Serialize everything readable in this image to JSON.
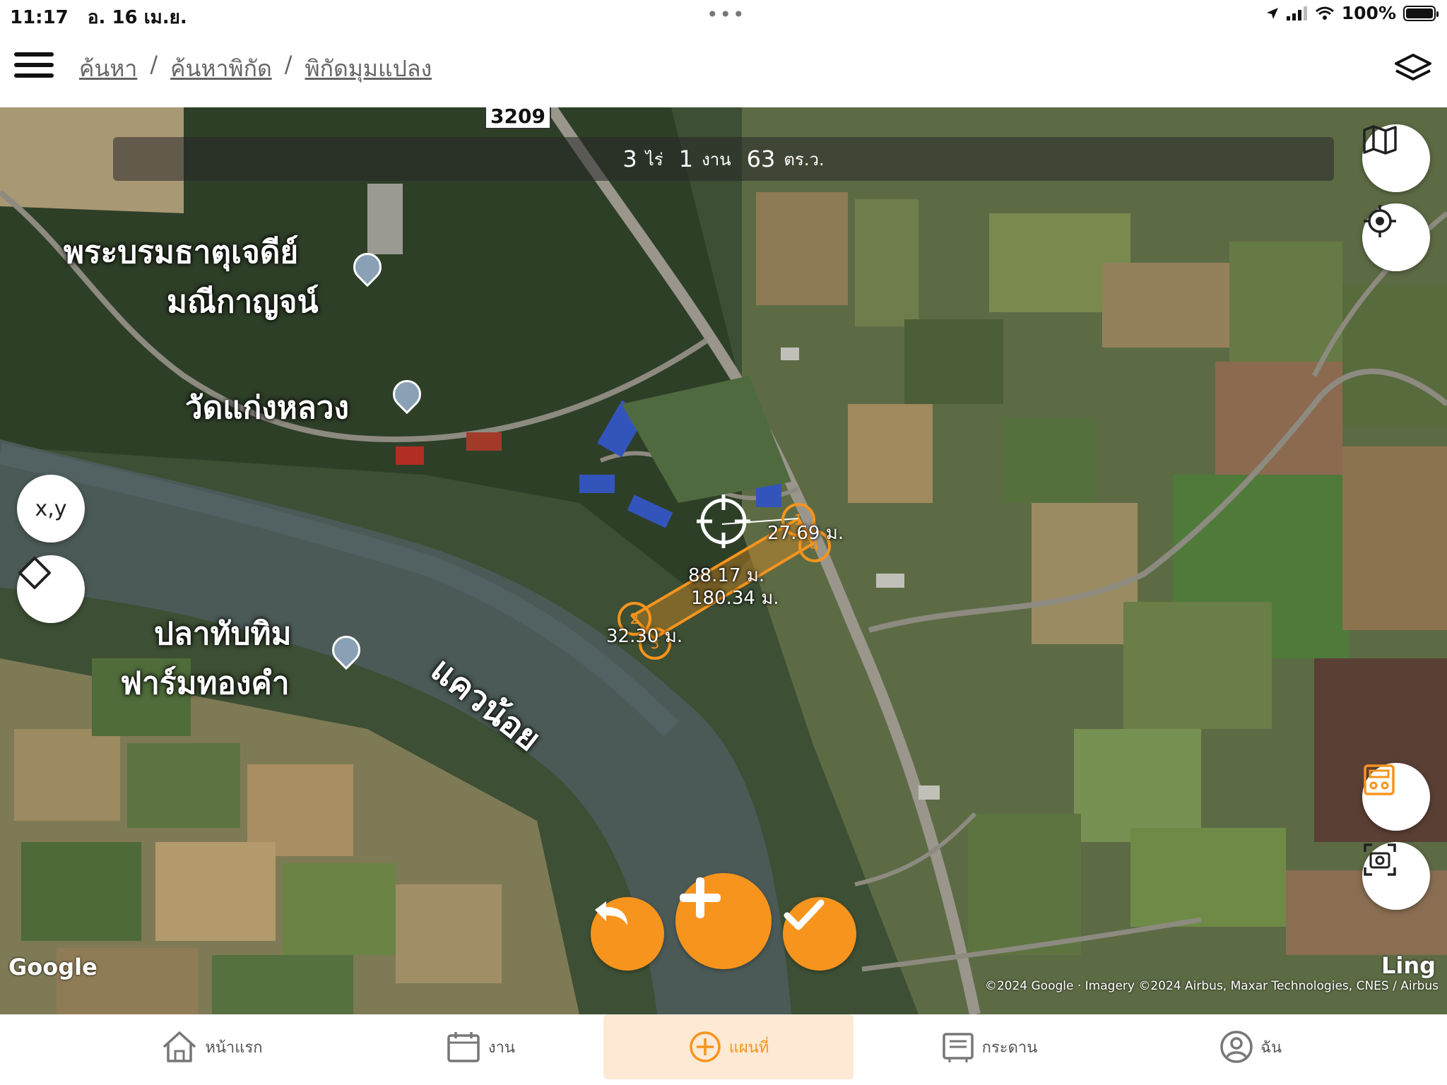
{
  "status": {
    "time": "11:17",
    "date": "อ. 16 เม.ย.",
    "battery": "100%"
  },
  "header": {
    "breadcrumb": [
      "ค้นหา",
      "ค้นหาพิกัด",
      "พิกัดมุมแปลง"
    ],
    "separator": "/"
  },
  "area": {
    "rai": "3",
    "rai_unit": "ไร่",
    "ngan": "1",
    "ngan_unit": "งาน",
    "wa": "63",
    "wa_unit": "ตร.ว."
  },
  "map": {
    "labels": {
      "temple_stupa_1": "พระบรมธาตุเจดีย์",
      "temple_stupa_2": "มณีกาญจน์",
      "temple": "วัดแก่งหลวง",
      "farm_1": "ปลาทับทิม",
      "farm_2": "ฟาร์มทองคำ",
      "river": "แควน้อย",
      "road_number": "3209"
    },
    "distances": {
      "d1": "27.69 ม.",
      "d2": "88.17 ม.",
      "d3": "180.34 ม.",
      "d4": "32.30 ม."
    },
    "markers": [
      "1",
      "2",
      "3",
      "4"
    ],
    "xy_button": "x,y",
    "google_logo": "Google",
    "attribution": "©2024 Google · Imagery ©2024 Airbus, Maxar Technologies, CNES / Airbus",
    "watermark": "Ling"
  },
  "colors": {
    "accent": "#f7941d",
    "accent_light": "#fde9d4"
  },
  "nav": {
    "items": [
      {
        "label": "หน้าแรก",
        "icon": "home-icon"
      },
      {
        "label": "งาน",
        "icon": "calendar-icon"
      },
      {
        "label": "แผนที่",
        "icon": "plus-circle-icon"
      },
      {
        "label": "กระดาน",
        "icon": "board-icon"
      },
      {
        "label": "ฉัน",
        "icon": "user-icon"
      }
    ],
    "active": "แผนที่"
  }
}
